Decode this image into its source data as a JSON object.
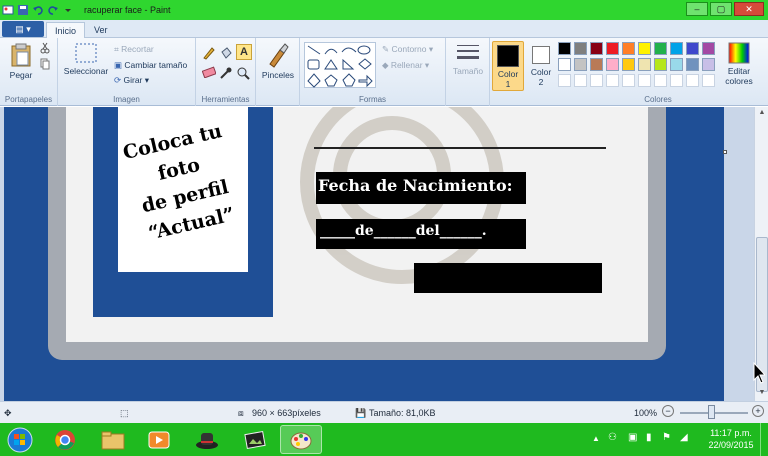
{
  "window": {
    "title": "racuperar face - Paint",
    "controls": {
      "minimize": "–",
      "maximize": "▢",
      "close": "✕"
    }
  },
  "menu": {
    "file_button": "▤ ▾",
    "tabs": [
      "Inicio",
      "Ver"
    ]
  },
  "ribbon": {
    "portapapeles": {
      "label": "Portapapeles",
      "paste": "Pegar"
    },
    "imagen": {
      "label": "Imagen",
      "select": "Seleccionar",
      "crop": "Recortar",
      "resize": "Cambiar tamaño",
      "rotate": "Girar ▾"
    },
    "herramientas": {
      "label": "Herramientas"
    },
    "pinceles": {
      "label": "Pinceles"
    },
    "formas": {
      "label": "Formas",
      "outline": "Contorno ▾",
      "fill": "Rellenar ▾"
    },
    "tamano": {
      "label": "Tamaño"
    },
    "color1": {
      "label": "Color",
      "num": "1"
    },
    "color2": {
      "label": "Color",
      "num": "2"
    },
    "colores": {
      "label": "Colores",
      "edit": "Editar",
      "edit2": "colores"
    }
  },
  "palette": [
    "#000000",
    "#7f7f7f",
    "#880015",
    "#ed1c24",
    "#ff7f27",
    "#fff200",
    "#22b14c",
    "#00a2e8",
    "#3f48cc",
    "#a349a4",
    "#ffffff",
    "#c3c3c3",
    "#b97a57",
    "#ffaec9",
    "#ffc90e",
    "#efe4b0",
    "#b5e61d",
    "#99d9ea",
    "#7092be",
    "#c8bfe7"
  ],
  "canvas": {
    "photo_text": [
      "Coloca tu foto",
      "de perfil",
      "“Actual”"
    ],
    "birth_label": "Fecha de Nacimiento:",
    "date_line": "_____de______del______."
  },
  "status": {
    "dimensions": "960 × 663píxeles",
    "size": "Tamaño: 81,0KB",
    "zoom": "100%"
  },
  "taskbar": {
    "time": "11:17 p.m.",
    "date": "22/09/2015"
  },
  "colors": {
    "titlebar": "#2fd62f",
    "taskbar": "#1fba1f",
    "card_blue": "#1f4f96"
  }
}
